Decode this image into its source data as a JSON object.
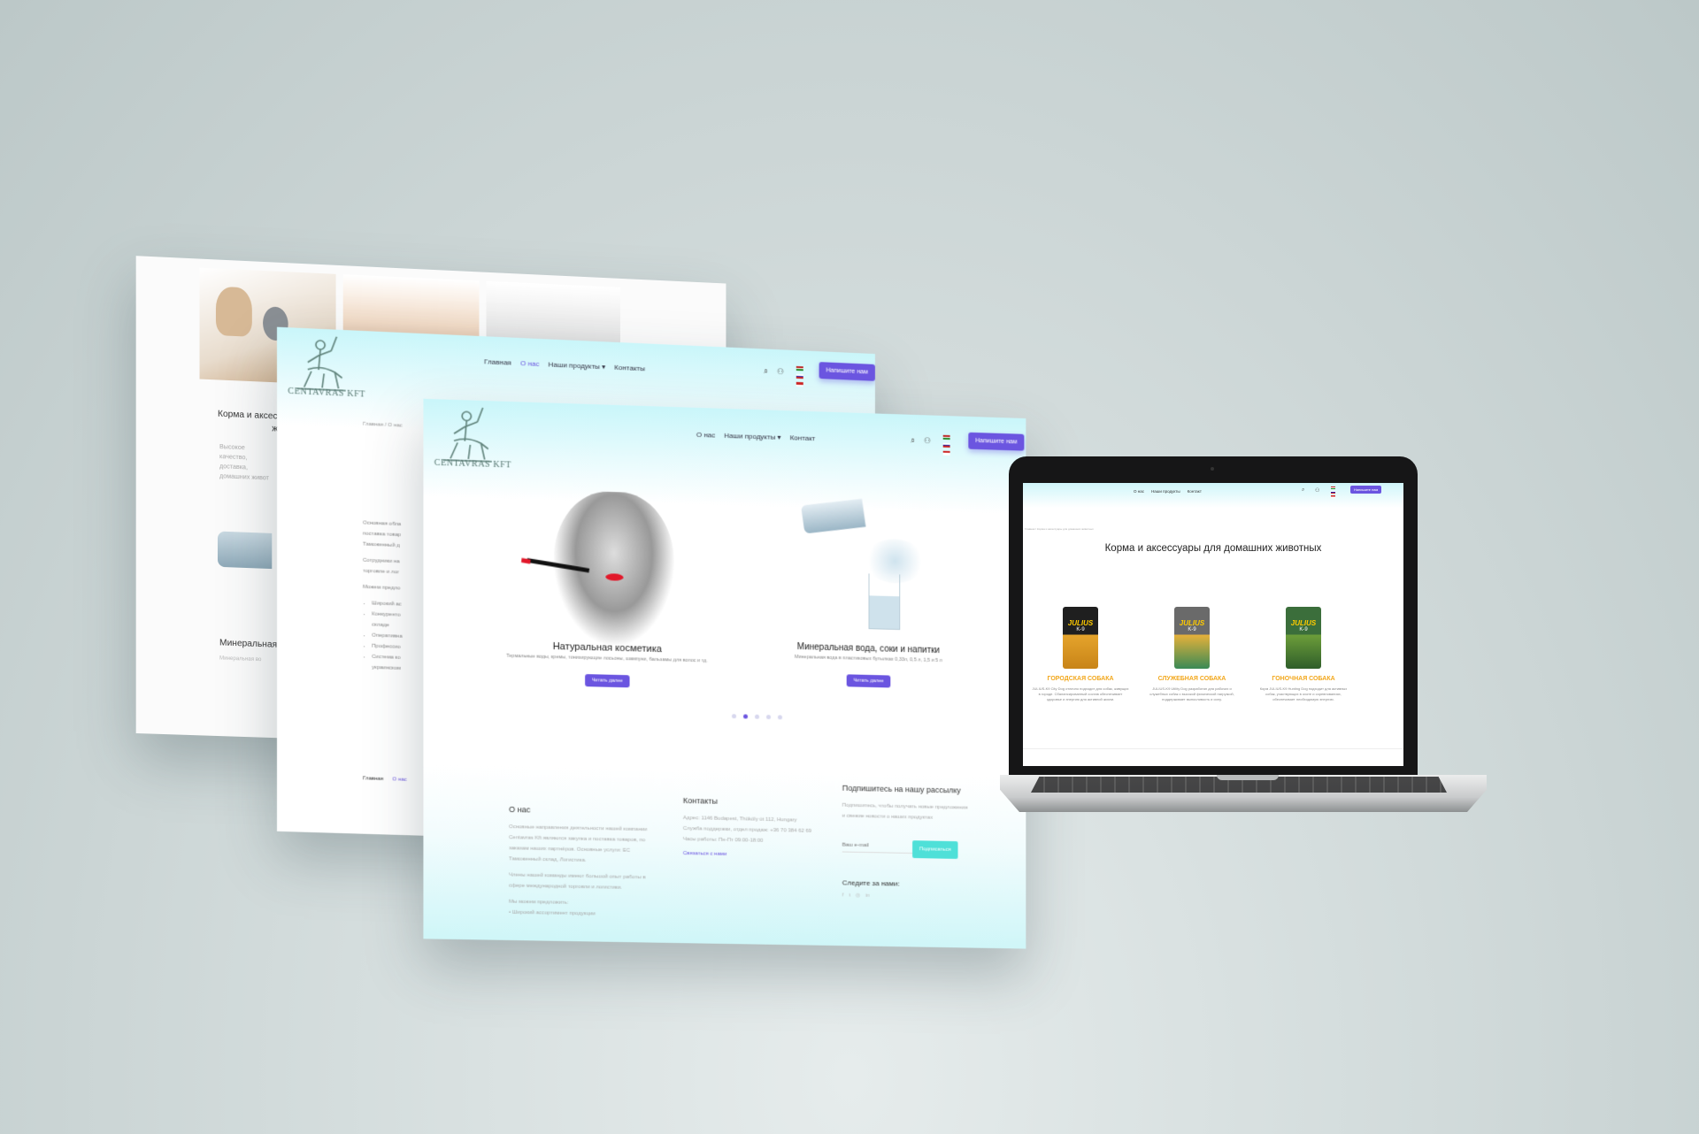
{
  "brand": {
    "name": "CENTAVRAS KFT",
    "accent": "#6b55e0",
    "header_tint": "#c9f6fa",
    "product_title_color": "#f2a71b"
  },
  "nav": {
    "home": "Главная",
    "about": "О нас",
    "products": "Наши продукты",
    "contacts": "Контакт",
    "contacts_alt": "Контакты",
    "cta": "Напишите нам"
  },
  "back_page": {
    "title": "Корма и аксес",
    "title2": "ж",
    "text": "Высокое качество, доставка, домашних живот",
    "mineral": "Минеральная",
    "mineral_text": "Минеральная во"
  },
  "mid_page": {
    "breadcrumb": "Главная / О нас",
    "body": [
      "Основная обла",
      "поставка товар",
      "Таможенный д",
      "Сотрудники на",
      "торговле и лог",
      "Можем предло"
    ],
    "list": [
      "Широкий ас",
      "Конкуренто",
      "складе",
      "Оперативна",
      "Профессио",
      "Система ко",
      "украинском"
    ],
    "bc_home": "Главная",
    "bc_about": "О нас"
  },
  "front_page": {
    "slides": [
      {
        "title": "Натуральная косметика",
        "desc": "Термальные воды, кремы, тонизирующие лосьоны, шампуни, бальзамы для волос и тд.",
        "btn": "Читать далее"
      },
      {
        "title": "Минеральная вода, соки и напитки",
        "desc": "Минеральная вода в пластиковых бутылках 0,33л, 0,5 л, 1,5 и 5 л",
        "btn": "Читать далее"
      }
    ],
    "footer": {
      "about_title": "О нас",
      "about_text": [
        "Основные направления деятельности нашей компании",
        "Centavras Kft являются закупка и поставка товаров, по",
        "заказам наших партнёров. Основные услуги: ЕС",
        "Таможенный склад, Логистика.",
        "",
        "Члены нашей команды имеют большой опыт работы в",
        "сфере международной торговли и логистики.",
        "",
        "Мы можем предложить:",
        "• Широкий ассортимент продукции"
      ],
      "contacts_title": "Контакты",
      "contacts_text": [
        "Адрес: 1146 Budapest, Thököly út 112, Hungary",
        "Служба поддержки, отдел продаж: +36 70 384 62 69",
        "Часы работы: Пн-Пт 09:00-18:00"
      ],
      "contacts_link": "Связаться с нами",
      "news_title": "Подпишитесь на нашу рассылку",
      "news_text": [
        "Подпишитесь, чтобы получать новые предложения",
        "и свежие новости о наших продуктах"
      ],
      "news_placeholder": "Ваш e-mail",
      "news_btn": "Подписаться",
      "follow": "Следите за нами:"
    }
  },
  "laptop_page": {
    "breadcrumb": "Главная / Корма и аксессуары для домашних животных",
    "title": "Корма и аксессуары для домашних животных",
    "products": [
      {
        "brand": "JULIUS",
        "model": "K-9",
        "name": "ГОРОДСКАЯ СОБАКА",
        "desc": "JULIUS-K9 City Dog отлично подходит для собак, живущих в городе. Сбалансированный состав обеспечивает здоровье и энергию для активной жизни."
      },
      {
        "brand": "JULIUS",
        "model": "K-9",
        "name": "СЛУЖЕБНАЯ СОБАКА",
        "desc": "JULIUS-K9 Utility Dog разработан для рабочих и служебных собак с высокой физической нагрузкой, поддерживает выносливость и силу."
      },
      {
        "brand": "JULIUS",
        "model": "K-9",
        "name": "ГОНОЧНАЯ СОБАКА",
        "desc": "Корм JULIUS-K9 Hunting Dog подходит для активных собак, участвующих в охоте и соревнованиях, обеспечивает необходимую энергию."
      }
    ]
  }
}
